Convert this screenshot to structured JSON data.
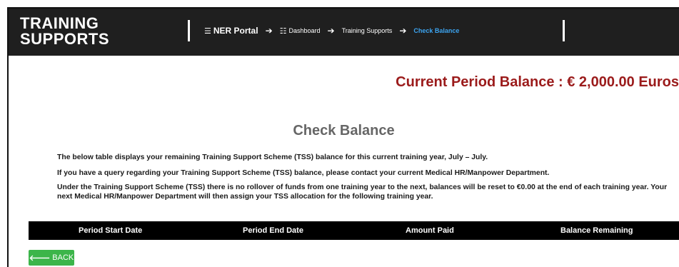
{
  "brand": {
    "line1": "TRAINING",
    "line2": "SUPPORTS"
  },
  "breadcrumb": {
    "items": [
      {
        "label": "NER Portal",
        "icon": "menu-icon"
      },
      {
        "label": "Dashboard",
        "icon": "list-icon"
      },
      {
        "label": "Training Supports"
      },
      {
        "label": "Check Balance"
      }
    ],
    "active_color": "#3ca4f0"
  },
  "balance": {
    "text": "Current Period Balance : € 2,000.00 Euros",
    "color": "#9b1b1b"
  },
  "page_title": "Check Balance",
  "paragraphs": [
    "The below table displays your remaining Training Support Scheme (TSS) balance for this current training year, July – July.",
    "If you have a query regarding your Training Support Scheme (TSS) balance, please contact your current Medical HR/Manpower Department.",
    "Under the Training Support Scheme (TSS) there is no rollover of funds from one training year to the next, balances will be reset to €0.00 at the end of each training year. Your next Medical HR/Manpower Department will then assign your TSS allocation for the following training year."
  ],
  "table": {
    "columns": [
      "Period Start Date",
      "Period End Date",
      "Amount Paid",
      "Balance Remaining"
    ],
    "rows": []
  },
  "back_button": {
    "label": "BACK",
    "icon": "arrow-left-icon",
    "color": "#3cb54a"
  }
}
